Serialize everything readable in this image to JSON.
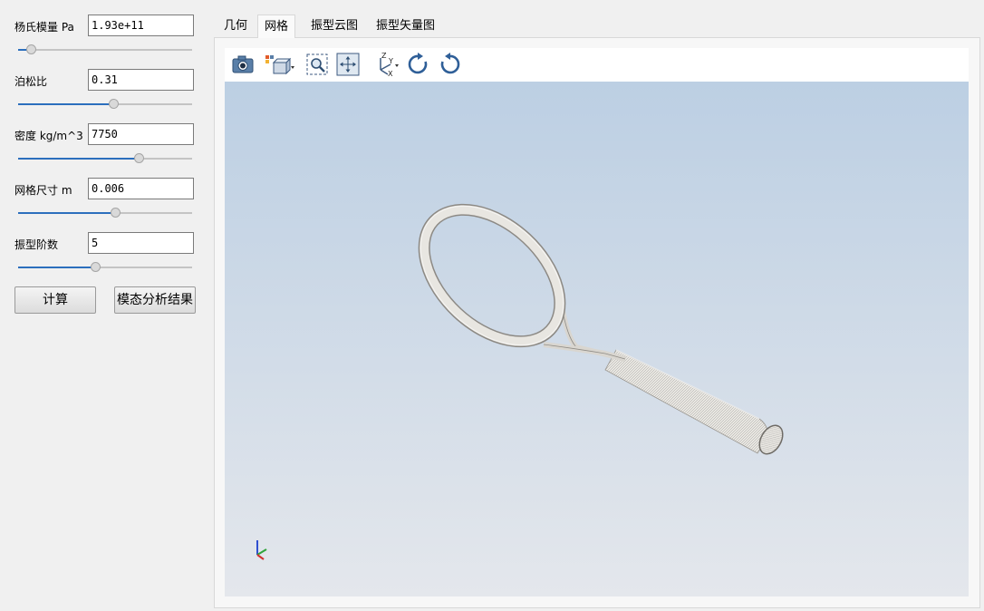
{
  "params": [
    {
      "label": "杨氏模量 Pa",
      "value": "1.93e+11",
      "slider_fraction": 0.08
    },
    {
      "label": "泊松比",
      "value": "0.31",
      "slider_fraction": 0.55
    },
    {
      "label": "密度 kg/m^3",
      "value": "7750",
      "slider_fraction": 0.7
    },
    {
      "label": "网格尺寸 m",
      "value": "0.006",
      "slider_fraction": 0.56
    },
    {
      "label": "振型阶数",
      "value": "5",
      "slider_fraction": 0.45
    }
  ],
  "buttons": {
    "compute": "计算",
    "modal_result": "模态分析结果"
  },
  "tabs": [
    "几何",
    "网格",
    "振型云图",
    "振型矢量图"
  ],
  "active_tab": 1,
  "toolbar_icons": [
    "camera-icon",
    "view-cube-icon",
    "zoom-box-icon",
    "fit-view-icon",
    "axes-orientation-icon",
    "rotate-clockwise-icon",
    "rotate-counterclockwise-icon"
  ],
  "colors": {
    "accent": "#2c6fbd",
    "viewport_top": "#bccfe3",
    "viewport_bottom": "#e4e7ec",
    "model": "#e6e4df"
  }
}
